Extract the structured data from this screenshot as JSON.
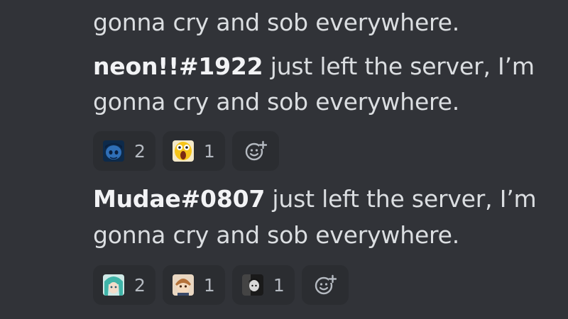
{
  "messages": [
    {
      "username": "",
      "text_line1": "",
      "text_line2": "gonna cry and sob everywhere."
    },
    {
      "username": "neon!!#1922",
      "text_line1": " just left the server, I’m",
      "text_line2": "gonna cry and sob everywhere.",
      "reactions": [
        {
          "emoji": "blue-face-emoji",
          "count": "2"
        },
        {
          "emoji": "yellow-scream-emoji",
          "count": "1"
        }
      ]
    },
    {
      "username": "Mudae#0807",
      "text_line1": " just left the server, I’m",
      "text_line2": "gonna cry and sob everywhere.",
      "reactions": [
        {
          "emoji": "teal-hair-anime-emoji",
          "count": "2"
        },
        {
          "emoji": "brown-hair-anime-emoji",
          "count": "1"
        },
        {
          "emoji": "dark-hair-anime-emoji",
          "count": "1"
        }
      ]
    }
  ],
  "colors": {
    "background": "#313338",
    "text": "#dbdee1",
    "username": "#f2f3f5",
    "reaction_bg": "#2b2d31",
    "reaction_count": "#b5bac1"
  }
}
